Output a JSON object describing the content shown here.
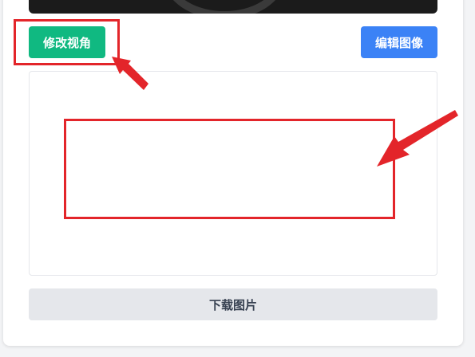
{
  "toolbar": {
    "change_view_label": "修改视角",
    "edit_image_label": "编辑图像"
  },
  "footer": {
    "download_label": "下载图片"
  },
  "colors": {
    "change_view_button": "#10b981",
    "edit_image_button": "#3b82f6",
    "download_button": "#e5e7eb",
    "annotation": "#e3252a"
  }
}
